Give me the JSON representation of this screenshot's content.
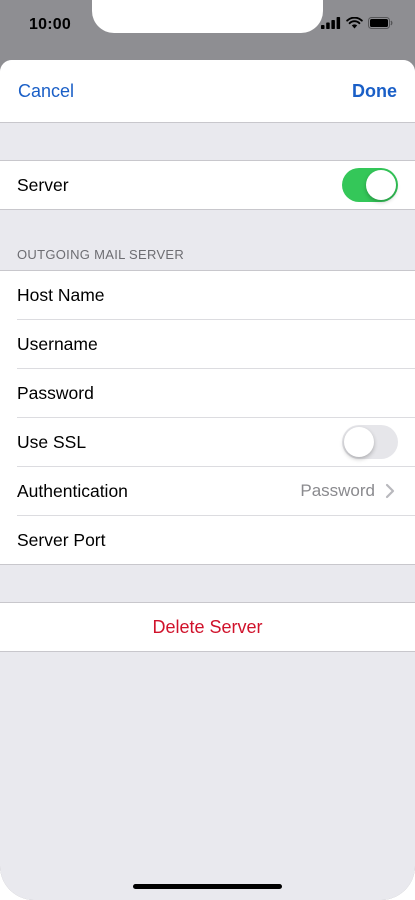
{
  "status_bar": {
    "time": "10:00"
  },
  "nav": {
    "cancel_label": "Cancel",
    "done_label": "Done"
  },
  "server_group": {
    "label": "Server",
    "toggle_on": true
  },
  "outgoing": {
    "header": "OUTGOING MAIL SERVER",
    "rows": {
      "host_name": "Host Name",
      "username": "Username",
      "password": "Password",
      "use_ssl": "Use SSL",
      "authentication": "Authentication",
      "authentication_value": "Password",
      "server_port": "Server Port"
    },
    "use_ssl_on": false
  },
  "delete_label": "Delete Server",
  "colors": {
    "accent": "#1a5fc7",
    "toggle_on": "#34c759",
    "destructive": "#d0122b"
  }
}
